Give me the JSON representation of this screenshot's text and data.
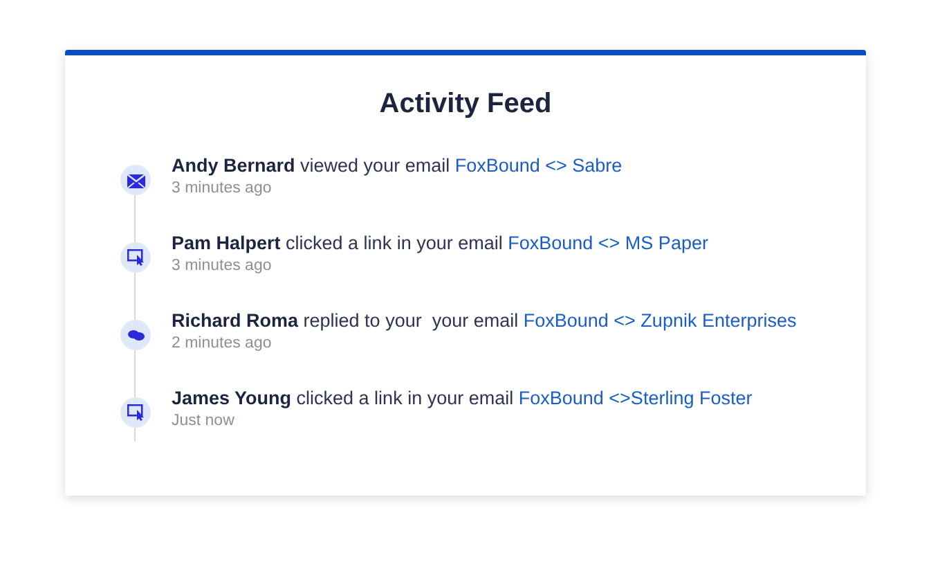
{
  "title": "Activity Feed",
  "activities": [
    {
      "kind": "email",
      "text": "**Andy Bernard** viewed your email",
      "link": "FoxBound <> Sabre",
      "time": "3 minutes ago"
    },
    {
      "kind": "click",
      "text": "**Pam Halpert** clicked a link in your email",
      "link": "FoxBound <> MS Paper",
      "time": "3 minutes ago"
    },
    {
      "kind": "reply",
      "text": "**Richard Roma** replied to your  your email",
      "link": "FoxBound <> Zupnik Enterprises",
      "time": "2 minutes ago"
    },
    {
      "kind": "click",
      "text": "**James Young** clicked a link in your email",
      "link": "FoxBound <>Sterling Foster",
      "time": "Just now"
    }
  ]
}
